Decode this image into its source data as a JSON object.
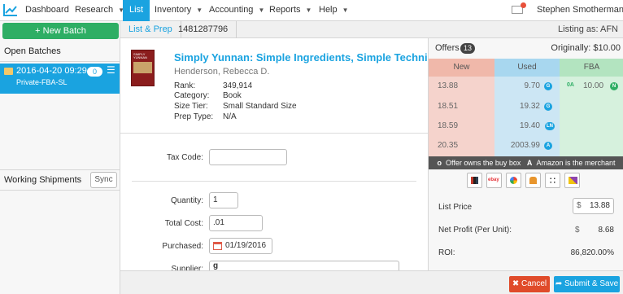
{
  "nav": {
    "items": [
      {
        "label": "Dashboard",
        "caret": false
      },
      {
        "label": "Research",
        "caret": true
      },
      {
        "label": "List",
        "caret": false
      },
      {
        "label": "Inventory",
        "caret": true
      },
      {
        "label": "Accounting",
        "caret": true
      },
      {
        "label": "Reports",
        "caret": true
      },
      {
        "label": "Help",
        "caret": true
      }
    ],
    "caret_glyph": "▼",
    "user_name": "Stephen Smotherman"
  },
  "sidebar": {
    "new_batch_label": "+ New Batch",
    "open_batches_label": "Open Batches",
    "batch": {
      "date": "2016-04-20 09:29",
      "name": "Private-FBA-SL",
      "count": "0"
    },
    "working_shipments_label": "Working Shipments",
    "sync_label": "Sync"
  },
  "breadcrumb": {
    "step": "List & Prep",
    "id": "1481287796",
    "listing_as": "Listing as: AFN"
  },
  "product": {
    "cover_text": "SIMPLY YUNNAN",
    "title": "Simply Yunnan: Simple Ingredients, Simple Technique",
    "author": "Henderson, Rebecca D.",
    "fields": [
      {
        "label": "Rank:",
        "value": "349,914"
      },
      {
        "label": "Category:",
        "value": "Book"
      },
      {
        "label": "Size Tier:",
        "value": "Small Standard Size"
      },
      {
        "label": "Prep Type:",
        "value": "N/A"
      }
    ]
  },
  "form": {
    "tax_code_label": "Tax Code:",
    "tax_code_value": "",
    "quantity_label": "Quantity:",
    "quantity_value": "1",
    "total_cost_label": "Total Cost:",
    "total_cost_value": ".01",
    "purchased_label": "Purchased:",
    "purchased_value": "01/19/2016",
    "supplier_label": "Supplier:",
    "supplier_value": "g"
  },
  "offers": {
    "title": "Offers",
    "count": "13",
    "originally": "Originally:  $10.00",
    "columns": {
      "new": "New",
      "used": "Used",
      "fba": "FBA"
    },
    "new_prices": [
      "13.88",
      "18.51",
      "18.59",
      "20.35"
    ],
    "used": [
      {
        "price": "9.70",
        "badge": "G"
      },
      {
        "price": "19.32",
        "badge": "G"
      },
      {
        "price": "19.40",
        "badge": "LN"
      },
      {
        "price": "2003.99",
        "badge": "A"
      }
    ],
    "fba": [
      {
        "tag": "0A",
        "price": "10.00",
        "badge": "N"
      }
    ],
    "legend": {
      "o_mark": "o",
      "o_text": "Offer owns the buy box",
      "a_mark": "A",
      "a_text": "Amazon is the merchant"
    },
    "external_icons": [
      "books-icon",
      "ebay-icon",
      "google-icon",
      "camel-icon",
      "dice-icon",
      "keepa-icon"
    ],
    "ebay_text": "ebay"
  },
  "pricing": {
    "list_price_label": "List Price",
    "currency": "$",
    "list_price_value": "13.88",
    "net_profit_label": "Net Profit (Per Unit):",
    "net_profit_currency": "$",
    "net_profit_value": "8.68",
    "roi_label": "ROI:",
    "roi_value": "86,820.00%"
  },
  "actions": {
    "cancel_label": "✖ Cancel",
    "save_label": "➦ Submit & Save"
  },
  "colors": {
    "accent": "#1aa3e0",
    "new_col": "#f5d3cc",
    "used_col": "#cce6f4",
    "fba_col": "#d6f1dd",
    "cancel": "#e04b2a",
    "new_batch": "#2eae64"
  }
}
